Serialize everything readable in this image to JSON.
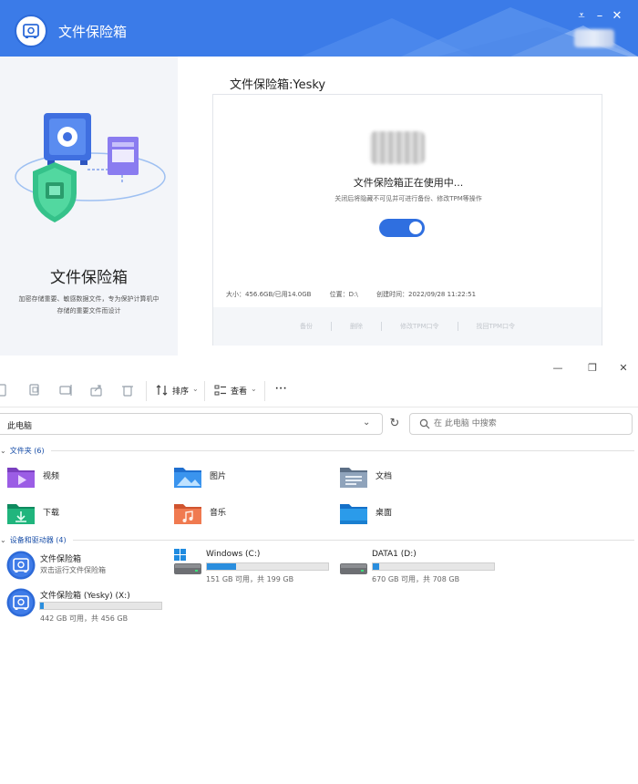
{
  "vault_window": {
    "title": "文件保险箱",
    "left_panel": {
      "title": "文件保险箱",
      "description": "加密存储重要、敏感数据文件，专为保护计算机中存储的重要文件而设计"
    },
    "heading": "文件保险箱:Yesky",
    "status_title": "文件保险箱正在使用中...",
    "status_subtitle": "关闭后将隐藏不可见并可进行备份、修改TPM等操作",
    "toggle_on": true,
    "info": {
      "size": "大小：456.6GB/已用14.0GB",
      "location": "位置：D:\\",
      "created": "创建时间：2022/09/28 11:22:51"
    },
    "actions": [
      "备份",
      "删除",
      "修改TPM口令",
      "找回TPM口令"
    ],
    "colors": {
      "titlebar": "#3b7be8",
      "toggle": "#2f6fe0"
    }
  },
  "explorer": {
    "toolbar": {
      "sort_label": "排序",
      "view_label": "查看",
      "more_label": "···"
    },
    "address": "此电脑",
    "search_placeholder": "在 此电脑 中搜索",
    "folders_section": "文件夹 (6)",
    "folders": [
      {
        "label": "视频",
        "icon": "video-folder-icon"
      },
      {
        "label": "图片",
        "icon": "pictures-folder-icon"
      },
      {
        "label": "文档",
        "icon": "documents-folder-icon"
      },
      {
        "label": "下载",
        "icon": "downloads-folder-icon"
      },
      {
        "label": "音乐",
        "icon": "music-folder-icon"
      },
      {
        "label": "桌面",
        "icon": "desktop-folder-icon"
      }
    ],
    "devices_section": "设备和驱动器 (4)",
    "drives": [
      {
        "name": "文件保险箱",
        "detail": "双击运行文件保险箱"
      },
      {
        "name": "Windows (C:)",
        "detail": "151 GB 可用，共 199 GB",
        "used_fraction": 0.24
      },
      {
        "name": "DATA1 (D:)",
        "detail": "670 GB 可用，共 708 GB",
        "used_fraction": 0.05
      },
      {
        "name": "文件保险箱 (Yesky) (X:)",
        "detail": "442 GB 可用，共 456 GB",
        "used_fraction": 0.03
      }
    ],
    "colors": {
      "section": "#1a4fa8",
      "usage_bar": "#2a8ede"
    }
  }
}
